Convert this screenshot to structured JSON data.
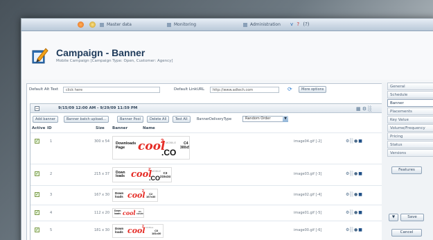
{
  "nav": {
    "items": [
      "Master data",
      "Monitoring",
      "Administration"
    ],
    "right_icons": [
      "v",
      "?",
      "(?)"
    ]
  },
  "header": {
    "title": "Campaign - Banner",
    "subtitle": "Mobile Campaign [Campaign Type: Open, Customer: Agency]"
  },
  "defaults": {
    "alt_text_label": "Default Alt Text",
    "alt_text_value": "click here",
    "link_url_label": "Default LinkURL",
    "link_url_value": "http://www.adtech.com",
    "more_options": "More options"
  },
  "panel": {
    "date_range": "9/15/09 12:00 AM - 9/29/09 11:59 PM",
    "buttons": [
      "Add banner",
      "Banner batch upload...",
      "Banner Pool",
      "Delete All",
      "Test All"
    ],
    "delivery_label": "BannerDeliveryType",
    "delivery_value": "Random Order",
    "columns": {
      "active": "Active",
      "id": "ID",
      "size": "Size",
      "banner": "Banner",
      "name": "Name"
    }
  },
  "rows": [
    {
      "id": "1",
      "size": "300 x 54",
      "file": "image04.gif [-2]",
      "dl": "Downloads Page",
      "code": "C4",
      "dim": "300x54",
      "mobile": "MOBILE",
      "suffix": ".CO"
    },
    {
      "id": "2",
      "size": "215 x 37",
      "file": "image03.gif [-3]",
      "dl": "Down loads",
      "code": "C3",
      "dim": "215x34",
      "mobile": "MOBILE",
      "suffix": ".CO"
    },
    {
      "id": "3",
      "size": "167 x 30",
      "file": "image02.gif [-4]",
      "dl": "Down loads",
      "code": "C2",
      "dim": "167x30",
      "mobile": "",
      "suffix": ""
    },
    {
      "id": "4",
      "size": "112 x 20",
      "file": "image01.gif [-5]",
      "dl": "Down loads",
      "code": "C1",
      "dim": "112x20",
      "mobile": "",
      "suffix": ""
    },
    {
      "id": "5",
      "size": "181 x 30",
      "file": "image00.gif [-6]",
      "dl": "Down loads",
      "code": "C0",
      "dim": "181x30",
      "mobile": "MOBILE",
      "suffix": ""
    }
  ],
  "sidebar": {
    "tabs": [
      "General",
      "Schedule",
      "Banner",
      "Placements",
      "Key Value",
      "Volume/Frequency",
      "Pricing",
      "Status",
      "Versions"
    ],
    "active": "Banner",
    "features": "Features",
    "save": "Save",
    "cancel": "Cancel"
  },
  "colors": {
    "accent": "#e52d27",
    "nav": "#b9c8d8",
    "title": "#1e3a5a"
  }
}
